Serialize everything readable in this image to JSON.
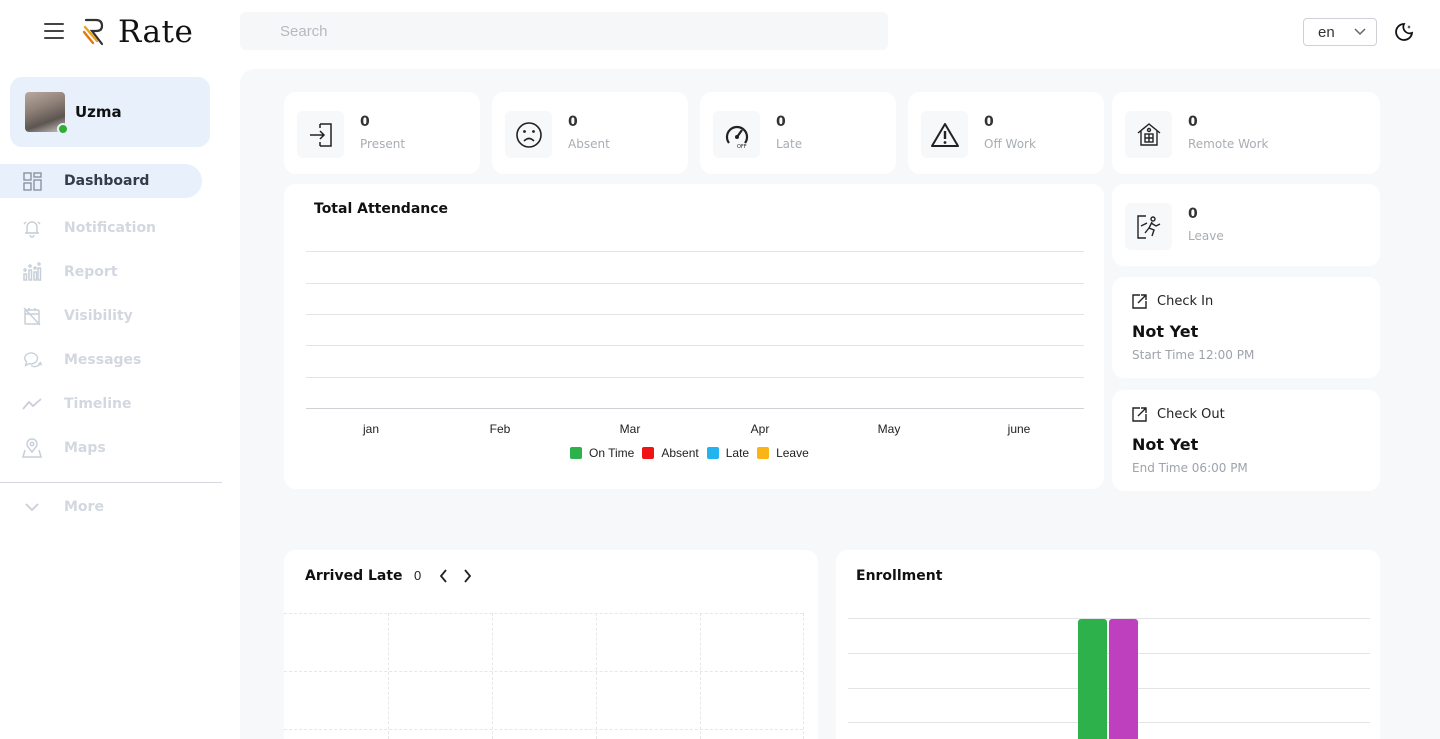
{
  "app": {
    "name": "Rate"
  },
  "search": {
    "placeholder": "Search"
  },
  "language": {
    "selected": "en"
  },
  "profile": {
    "name": "Uzma",
    "status_color": "#2eb02e"
  },
  "sidebar": {
    "items": [
      {
        "label": "Dashboard",
        "icon": "dashboard-icon"
      },
      {
        "label": "Notification",
        "icon": "bell-icon"
      },
      {
        "label": "Report",
        "icon": "report-icon"
      },
      {
        "label": "Visibility",
        "icon": "calendar-off-icon"
      },
      {
        "label": "Messages",
        "icon": "chat-icon"
      },
      {
        "label": "Timeline",
        "icon": "trend-icon"
      },
      {
        "label": "Maps",
        "icon": "map-pin-icon"
      }
    ],
    "more_label": "More"
  },
  "stats": [
    {
      "value": "0",
      "label": "Present",
      "icon": "enter-door-icon"
    },
    {
      "value": "0",
      "label": "Absent",
      "icon": "sad-face-icon"
    },
    {
      "value": "0",
      "label": "Late",
      "icon": "speedometer-off-icon"
    },
    {
      "value": "0",
      "label": "Off Work",
      "icon": "warning-icon"
    },
    {
      "value": "0",
      "label": "Remote Work",
      "icon": "home-icon"
    },
    {
      "value": "0",
      "label": "Leave",
      "icon": "exit-run-icon"
    }
  ],
  "attendance_chart": {
    "title": "Total Attendance",
    "months": [
      "jan",
      "Feb",
      "Mar",
      "Apr",
      "May",
      "june"
    ],
    "legend": [
      {
        "label": "On Time",
        "color": "#2db14b"
      },
      {
        "label": "Absent",
        "color": "#f01313"
      },
      {
        "label": "Late",
        "color": "#22b3f0"
      },
      {
        "label": "Leave",
        "color": "#fab416"
      }
    ]
  },
  "check_in": {
    "title": "Check In",
    "status": "Not Yet",
    "time": "Start Time 12:00 PM"
  },
  "check_out": {
    "title": "Check Out",
    "status": "Not Yet",
    "time": "End Time 06:00 PM"
  },
  "arrived_late": {
    "title": "Arrived Late",
    "count": "0"
  },
  "enrollment": {
    "title": "Enrollment",
    "bar_colors": [
      "#2db14b",
      "#bf40bf"
    ]
  }
}
